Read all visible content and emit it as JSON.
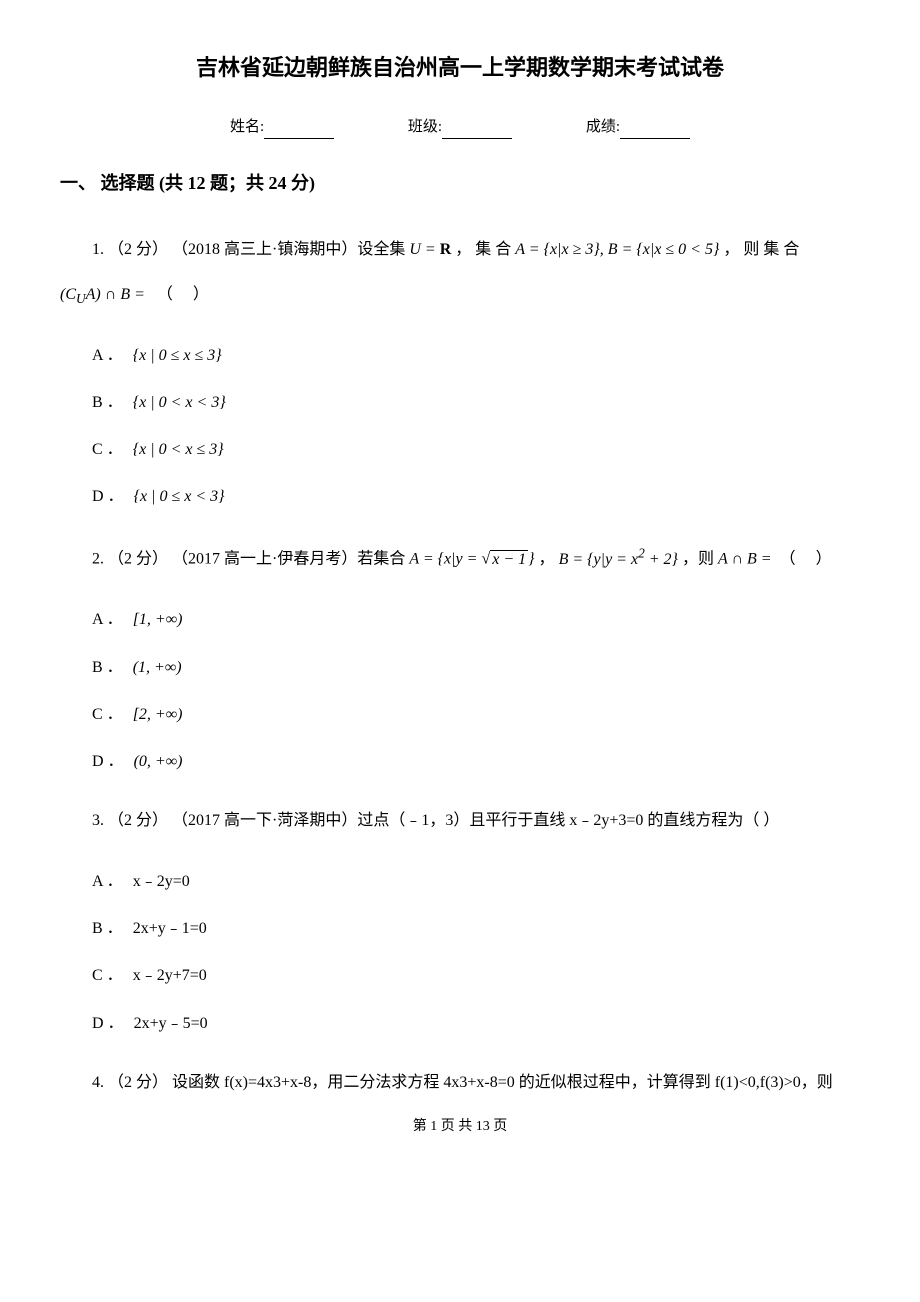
{
  "title": "吉林省延边朝鲜族自治州高一上学期数学期末考试试卷",
  "info": {
    "name_label": "姓名:",
    "class_label": "班级:",
    "score_label": "成绩:"
  },
  "section1": {
    "header": "一、 选择题 (共 12 题；共 24 分)"
  },
  "q1": {
    "prefix": "1. （2 分） （2018 高三上·镇海期中）设全集 ",
    "u_eq": "U = R",
    "mid1": " ， 集 合 ",
    "seta": "A = {x|x ≥ 3}, B = {x|x ≤ 0 < 5}",
    "mid2": " ， 则 集 合",
    "expr": "(C_U A) ∩ B =",
    "tail": "（  ）",
    "optA": "{x | 0 ≤ x ≤ 3}",
    "optB": "{x | 0 < x < 3}",
    "optC": "{x | 0 < x ≤ 3}",
    "optD": "{x | 0 ≤ x < 3}"
  },
  "q2": {
    "prefix": "2. （2 分） （2017 高一上·伊春月考）若集合 ",
    "setA": "A = {x|y = √(x−1)}",
    "mid1": " ， ",
    "setB": "B = {y|y = x² + 2}",
    "mid2": " ，则 ",
    "expr": "A ∩ B =",
    "tail": " （  ）",
    "optA": "[1, +∞)",
    "optB": "(1, +∞)",
    "optC": "[2, +∞)",
    "optD": "(0, +∞)"
  },
  "q3": {
    "prefix": "3. （2 分） （2017 高一下·菏泽期中）过点（﹣1，3）且平行于直线 x﹣2y+3=0 的直线方程为（  ）",
    "optA": "x﹣2y=0",
    "optB": "2x+y﹣1=0",
    "optC": "x﹣2y+7=0",
    "optD": "2x+y﹣5=0"
  },
  "q4": {
    "line": "4. （2 分） 设函数 f(x)=4x3+x-8，用二分法求方程 4x3+x-8=0 的近似根过程中，计算得到 f(1)<0,f(3)>0，则"
  },
  "footer": "第 1 页 共 13 页",
  "labels": {
    "A": "A ．",
    "B": "B ．",
    "C": "C ．",
    "D": "D ．"
  }
}
